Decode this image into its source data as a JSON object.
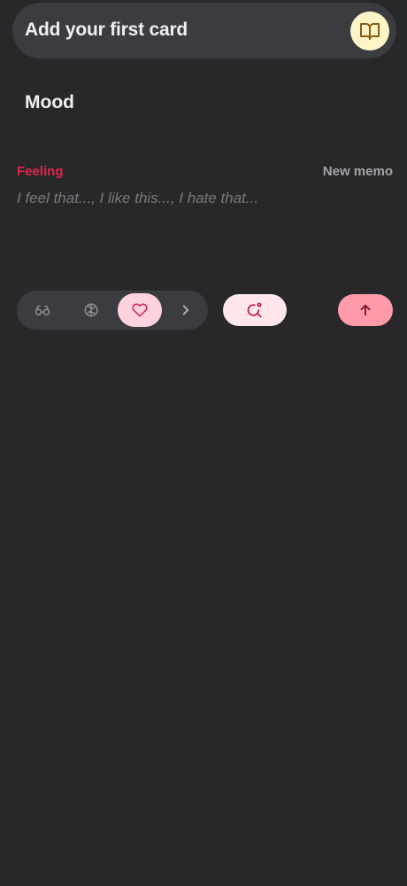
{
  "header": {
    "title": "Add your first card",
    "icon": "book-open-icon",
    "icon_bg": "#fff4c7"
  },
  "section": {
    "title": "Mood"
  },
  "memo": {
    "label": "Feeling",
    "label_color": "#e0254e",
    "new_memo_label": "New memo",
    "placeholder": "I feel that..., I like this..., I hate that..."
  },
  "categories": {
    "items": [
      {
        "icon": "glasses-icon",
        "active": false
      },
      {
        "icon": "brain-icon",
        "active": false
      },
      {
        "icon": "heart-icon",
        "active": true
      }
    ],
    "more_icon": "chevron-right-icon"
  },
  "actions": {
    "search_icon": "search-sparkle-icon",
    "send_icon": "arrow-up-icon",
    "accent_color": "#ff9aaa"
  }
}
